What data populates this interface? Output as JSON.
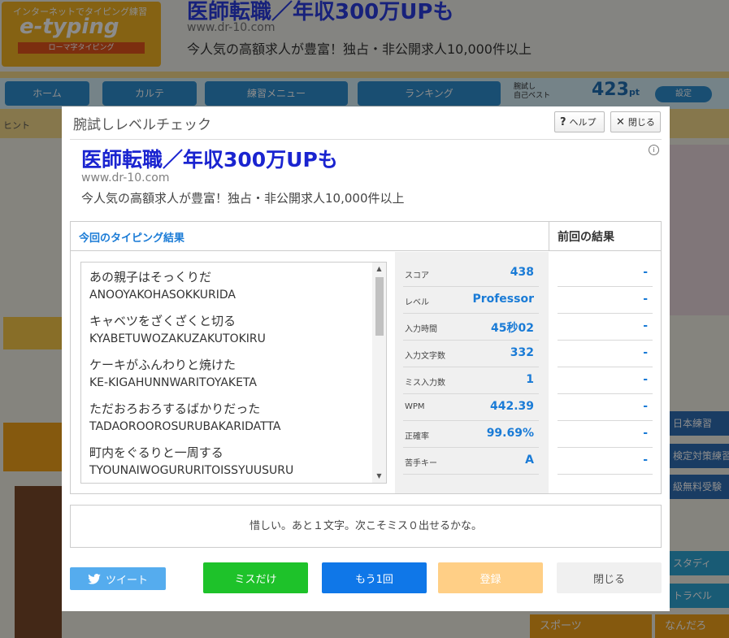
{
  "background": {
    "logo_top": "インターネットでタイピング練習",
    "logo_main": "e-typing",
    "logo_sub": "ローマ字タイピング",
    "ad_title": "医師転職／年収300万UPも",
    "ad_url": "www.dr-10.com",
    "ad_desc": "今人気の高額求人が豊富！独占・非公開求人10,000件以上",
    "nav": [
      "ホーム",
      "カルテ",
      "練習メニュー",
      "ランキング"
    ],
    "best_label": "腕試し\n自己ベスト",
    "best_score": "423",
    "best_unit": "pt",
    "settings": "設定",
    "hint": "ヒント",
    "right_btns": [
      "日本練習",
      "検定対策練習",
      "級無料受験"
    ],
    "right_btn2": [
      "スタディ",
      "トラベル"
    ],
    "bottom1": "スポーツ",
    "bottom2": "なんだろ"
  },
  "modal": {
    "title": "腕試しレベルチェック",
    "help_label": "ヘルプ",
    "close_label": "閉じる",
    "ad": {
      "title": "医師転職／年収300万UPも",
      "url": "www.dr-10.com",
      "desc": "今人気の高額求人が豊富！独占・非公開求人10,000件以上"
    },
    "current_header": "今回のタイピング結果",
    "previous_header": "前回の結果",
    "words": [
      {
        "jp": "あの親子はそっくりだ",
        "romaji": "ANOOYAKOHASOKKURIDA"
      },
      {
        "jp": "キャベツをざくざくと切る",
        "romaji": "KYABETUWOZAKUZAKUTOKIRU"
      },
      {
        "jp": "ケーキがふんわりと焼けた",
        "romaji": "KE-KIGAHUNNWARITOYAKETA"
      },
      {
        "jp": "ただおろおろするばかりだった",
        "romaji": "TADAOROOROSURUBAKARIDATTA"
      },
      {
        "jp": "町内をぐるりと一周する",
        "romaji": "TYOUNAIWOGURURITOISSYUUSURU"
      }
    ],
    "stats": [
      {
        "label": "スコア",
        "value": "438",
        "prev": "-"
      },
      {
        "label": "レベル",
        "value": "Professor",
        "prev": "-"
      },
      {
        "label": "入力時間",
        "value": "45秒02",
        "prev": "-"
      },
      {
        "label": "入力文字数",
        "value": "332",
        "prev": "-"
      },
      {
        "label": "ミス入力数",
        "value": "1",
        "prev": "-"
      },
      {
        "label": "WPM",
        "value": "442.39",
        "prev": "-"
      },
      {
        "label": "正確率",
        "value": "99.69%",
        "prev": "-"
      },
      {
        "label": "苦手キー",
        "value": "A",
        "prev": "-"
      }
    ],
    "message": "惜しい。あと１文字。次こそミス０出せるかな。",
    "buttons": {
      "tweet": "ツイート",
      "miss_only": "ミスだけ",
      "again": "もう1回",
      "register": "登録",
      "close": "閉じる"
    }
  },
  "colors": {
    "accent_blue": "#1a7bd6",
    "ad_title": "#1a24d0",
    "tweet": "#55acee",
    "miss_only": "#1ec22a",
    "again": "#0f77e8",
    "register_disabled": "#ffcf86"
  }
}
